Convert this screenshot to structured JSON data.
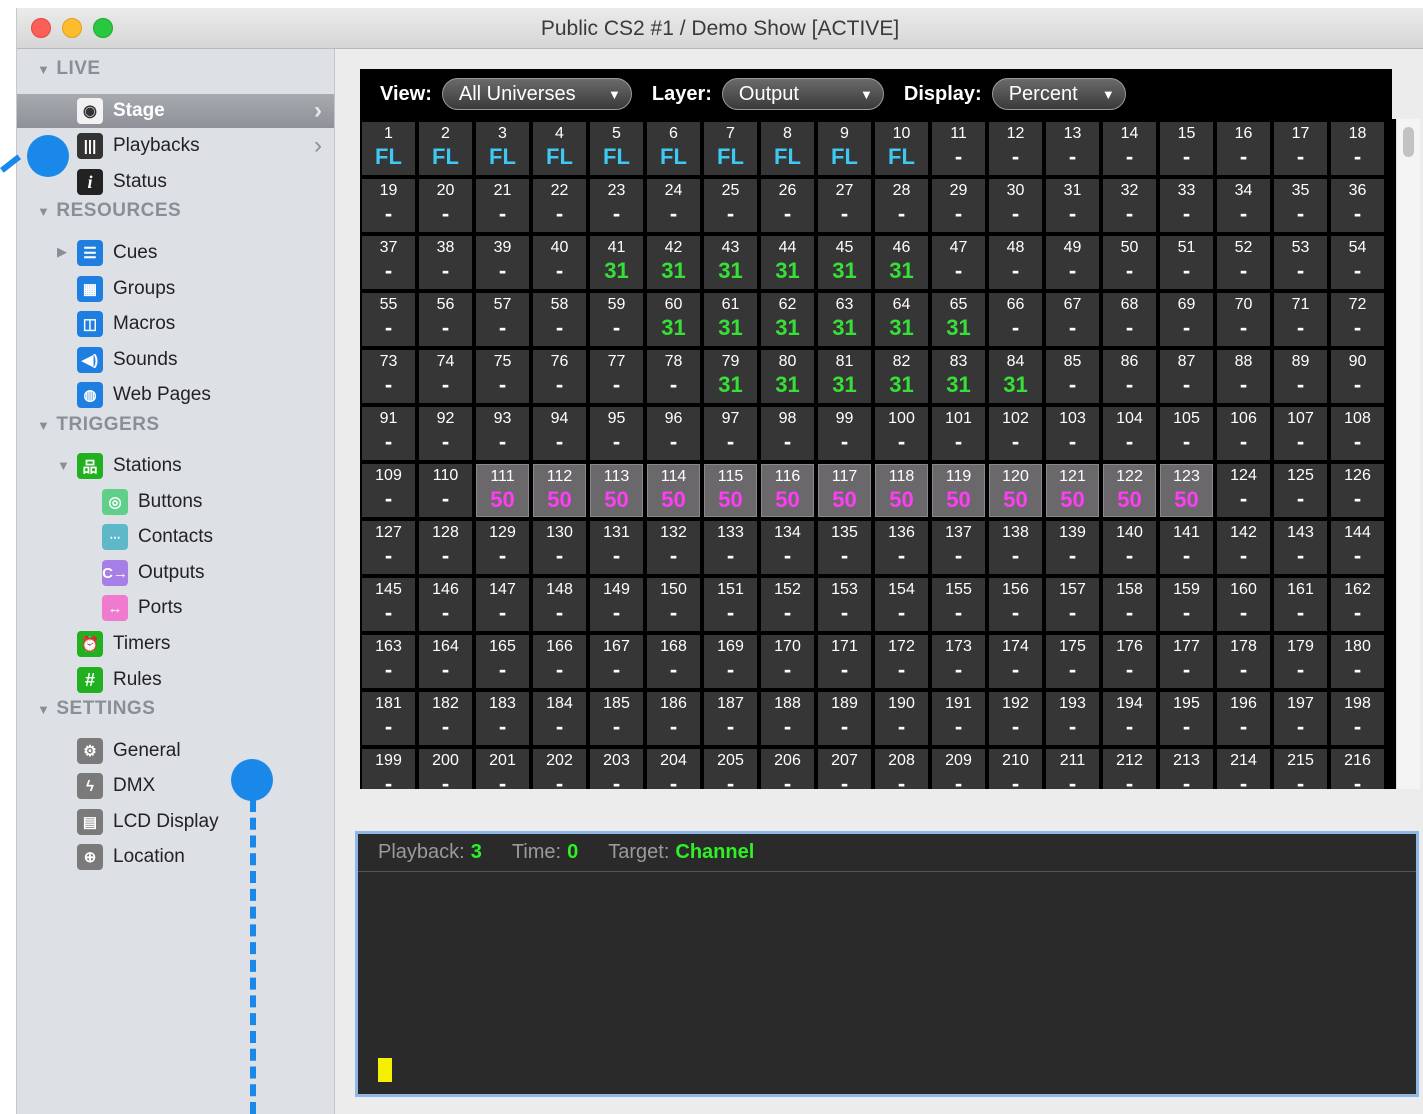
{
  "window": {
    "title": "Public CS2 #1 / Demo Show [ACTIVE]"
  },
  "sidebar": {
    "sections": {
      "live": "LIVE",
      "resources": "RESOURCES",
      "triggers": "TRIGGERS",
      "settings": "SETTINGS"
    },
    "items": {
      "stage": "Stage",
      "playbacks": "Playbacks",
      "status": "Status",
      "cues": "Cues",
      "groups": "Groups",
      "macros": "Macros",
      "sounds": "Sounds",
      "web_pages": "Web Pages",
      "stations": "Stations",
      "buttons": "Buttons",
      "contacts": "Contacts",
      "outputs": "Outputs",
      "ports": "Ports",
      "timers": "Timers",
      "rules": "Rules",
      "general": "General",
      "dmx": "DMX",
      "lcd_display": "LCD Display",
      "location": "Location"
    },
    "icons": {
      "stage": "eye-icon",
      "playbacks": "sliders-icon",
      "status": "info-icon",
      "cues": "list-icon",
      "groups": "grid-icon",
      "macros": "macro-icon",
      "sounds": "speaker-icon",
      "web_pages": "globe-icon",
      "stations": "network-icon",
      "buttons": "button-icon",
      "contacts": "contact-icon",
      "outputs": "output-icon",
      "ports": "ports-icon",
      "timers": "alarm-clock-icon",
      "rules": "hash-icon",
      "general": "gear-icon",
      "dmx": "lightning-icon",
      "lcd_display": "lcd-icon",
      "location": "location-icon"
    }
  },
  "toolbar": {
    "view_label": "View:",
    "view_value": "All Universes",
    "layer_label": "Layer:",
    "layer_value": "Output",
    "display_label": "Display:",
    "display_value": "Percent"
  },
  "channels": {
    "first": 1,
    "last": 216,
    "columns": 18,
    "empty_value": "-",
    "values": {
      "1": "FL",
      "2": "FL",
      "3": "FL",
      "4": "FL",
      "5": "FL",
      "6": "FL",
      "7": "FL",
      "8": "FL",
      "9": "FL",
      "10": "FL",
      "41": "31",
      "42": "31",
      "43": "31",
      "44": "31",
      "45": "31",
      "46": "31",
      "60": "31",
      "61": "31",
      "62": "31",
      "63": "31",
      "64": "31",
      "65": "31",
      "79": "31",
      "80": "31",
      "81": "31",
      "82": "31",
      "83": "31",
      "84": "31",
      "111": "50",
      "112": "50",
      "113": "50",
      "114": "50",
      "115": "50",
      "116": "50",
      "117": "50",
      "118": "50",
      "119": "50",
      "120": "50",
      "121": "50",
      "122": "50",
      "123": "50"
    },
    "highlighted": [
      111,
      112,
      113,
      114,
      115,
      116,
      117,
      118,
      119,
      120,
      121,
      122,
      123
    ],
    "colors": {
      "FL": "#3ec9f4",
      "31": "#36e036",
      "50": "#ff3df5",
      "default": "#ffffff"
    }
  },
  "console": {
    "playback_label": "Playback:",
    "playback_value": "3",
    "time_label": "Time:",
    "time_value": "0",
    "target_label": "Target:",
    "target_value": "Channel"
  }
}
